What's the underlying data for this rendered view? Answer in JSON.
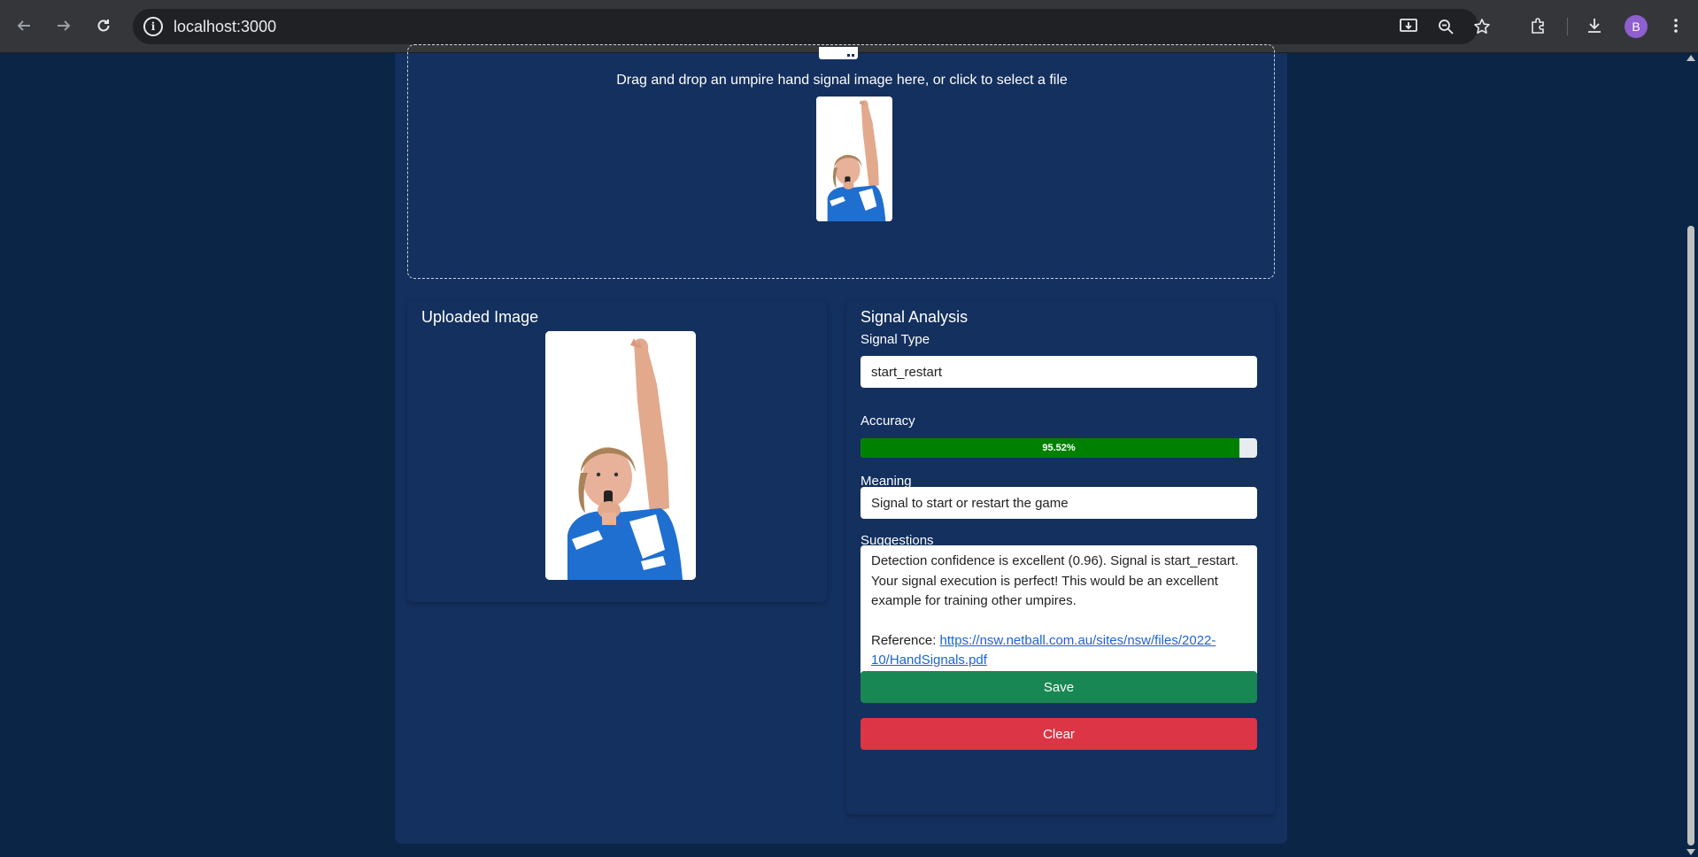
{
  "browser": {
    "url": "localhost:3000",
    "profile_initial": "B"
  },
  "dropzone": {
    "text": "Drag and drop an umpire hand signal image here, or click to select a file"
  },
  "uploaded": {
    "title": "Uploaded Image"
  },
  "analysis": {
    "title": "Signal Analysis",
    "signal_type_label": "Signal Type",
    "signal_type_value": "start_restart",
    "accuracy_label": "Accuracy",
    "accuracy_value": 0.9552,
    "accuracy_text": "95.52%",
    "meaning_label": "Meaning",
    "meaning_value": "Signal to start or restart the game",
    "suggestions_label": "Suggestions",
    "suggestions_text": "Detection confidence is excellent (0.96). Signal is start_restart. Your signal execution is perfect! This would be an excellent example for training other umpires.",
    "reference_prefix": "Reference: ",
    "reference_link": "https://nsw.netball.com.au/sites/nsw/files/2022-10/HandSignals.pdf",
    "save_label": "Save",
    "clear_label": "Clear"
  },
  "colors": {
    "page_bg": "#0b2546",
    "panel_bg": "#14305e",
    "progress_fill": "#008000",
    "save": "#198754",
    "clear": "#dc3545",
    "link": "#1a64d6"
  },
  "icons": {
    "back": "arrow-left-icon",
    "forward": "arrow-right-icon",
    "reload": "reload-icon",
    "site_info": "info-icon",
    "install": "install-app-icon",
    "zoom": "zoom-out-icon",
    "bookmark": "star-icon",
    "extensions": "puzzle-icon",
    "downloads": "download-icon",
    "menu": "kebab-menu-icon",
    "upload": "upload-icon"
  }
}
